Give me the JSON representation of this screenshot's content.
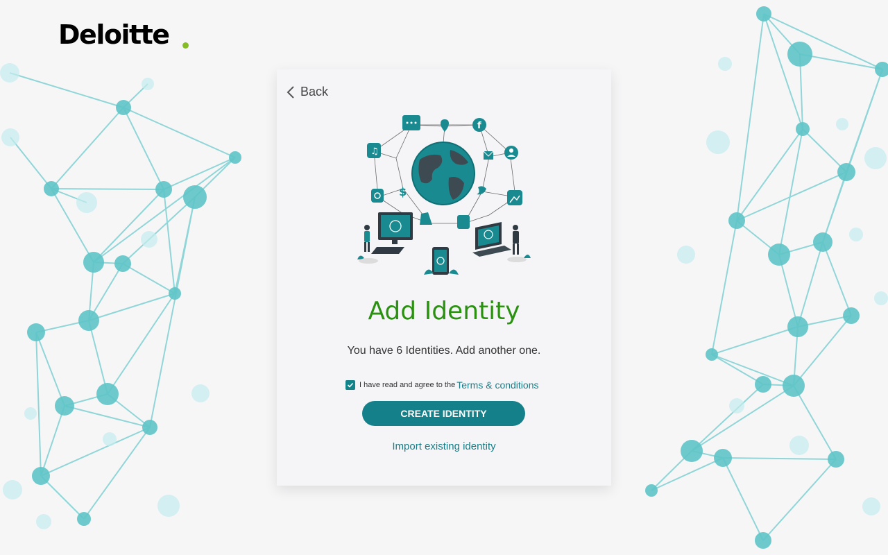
{
  "brand": {
    "logo_text": "Deloitte"
  },
  "card": {
    "back_label": "Back",
    "title": "Add Identity",
    "subtitle": "You have 6 Identities. Add another one.",
    "agree_text": "I have read and agree to the",
    "terms_link": "Terms & conditions",
    "agree_checked": true,
    "create_button": "CREATE IDENTITY",
    "import_link": "Import existing identity"
  },
  "colors": {
    "accent": "#148089",
    "title_green": "#2b9110",
    "logo_dot": "#86bc25",
    "network": "#5ec4c7"
  },
  "illustration": {
    "icons": [
      "chat-icon",
      "location-pin-icon",
      "facebook-icon",
      "music-icon",
      "mail-icon",
      "user-icon",
      "instagram-icon",
      "dollar-icon",
      "twitter-icon",
      "image-icon",
      "thumbs-up-icon",
      "cone-icon"
    ],
    "scene": "globe-network-with-people-and-devices"
  }
}
